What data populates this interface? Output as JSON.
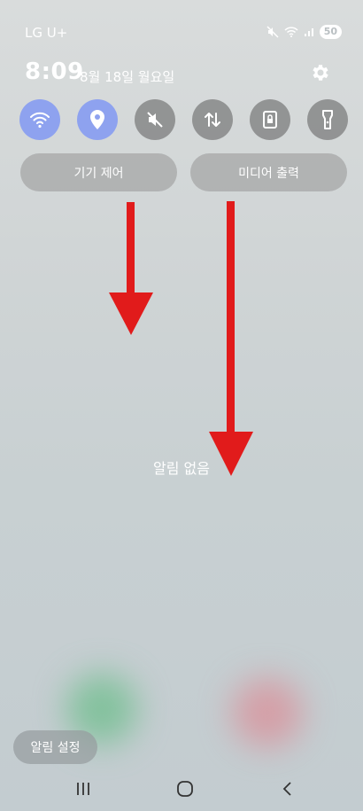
{
  "status_bar": {
    "carrier": "LG U+",
    "battery": "50"
  },
  "header": {
    "time": "8:09",
    "date": "8월 18일 월요일"
  },
  "quick_toggles": [
    {
      "name": "wifi",
      "state": "on"
    },
    {
      "name": "location",
      "state": "on"
    },
    {
      "name": "mute",
      "state": "off"
    },
    {
      "name": "mobile-data",
      "state": "off"
    },
    {
      "name": "screen-lock",
      "state": "off"
    },
    {
      "name": "flashlight",
      "state": "off"
    }
  ],
  "buttons": {
    "device_control": "기기 제어",
    "media_output": "미디어 출력"
  },
  "notifications": {
    "empty_text": "알림 없음",
    "settings_label": "알림 설정"
  },
  "colors": {
    "toggle_active": "#8ea2ef",
    "toggle_inactive": "#787878",
    "annotation_arrow": "#e11b1b"
  }
}
